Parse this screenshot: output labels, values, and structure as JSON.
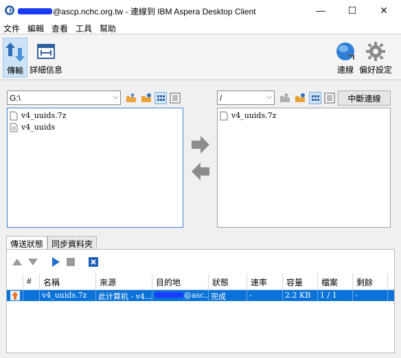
{
  "window": {
    "title_suffix": "@ascp.nchc.org.tw - 連線到 IBM Aspera Desktop Client",
    "minimize": "—",
    "maximize": "☐",
    "close": "✕"
  },
  "menu": [
    "文件",
    "編輯",
    "查看",
    "工具",
    "幫助"
  ],
  "toolbar": {
    "transfer": "傳輸",
    "details": "詳細信息",
    "connect": "連線",
    "preferences": "偏好設定"
  },
  "local": {
    "path": "G:\\",
    "files": [
      {
        "name": "v4_uuids.7z"
      },
      {
        "name": "v4_uuids"
      }
    ]
  },
  "remote": {
    "path": "/",
    "files": [
      {
        "name": "v4_uuids.7z"
      }
    ],
    "disconnect": "中斷連線"
  },
  "tabs": {
    "status": "傳送狀態",
    "sync": "同步資料夾"
  },
  "transfers": {
    "columns": [
      "#",
      "名稱",
      "來源",
      "目的地",
      "狀態",
      "速率",
      "容量",
      "檔案",
      "剩餘"
    ],
    "rows": [
      {
        "num": "",
        "name": "v4_uuids.7z",
        "source": "此计算机 - v4...",
        "destination_suffix": "@asc...",
        "status": "完成",
        "rate": "-",
        "size": "2.2 KB",
        "files": "1 / 1",
        "remaining": "-"
      }
    ]
  },
  "colors": {
    "selection": "#0a73d9",
    "pane_focus": "#3b7fd0",
    "redaction": "#1a3cff"
  }
}
